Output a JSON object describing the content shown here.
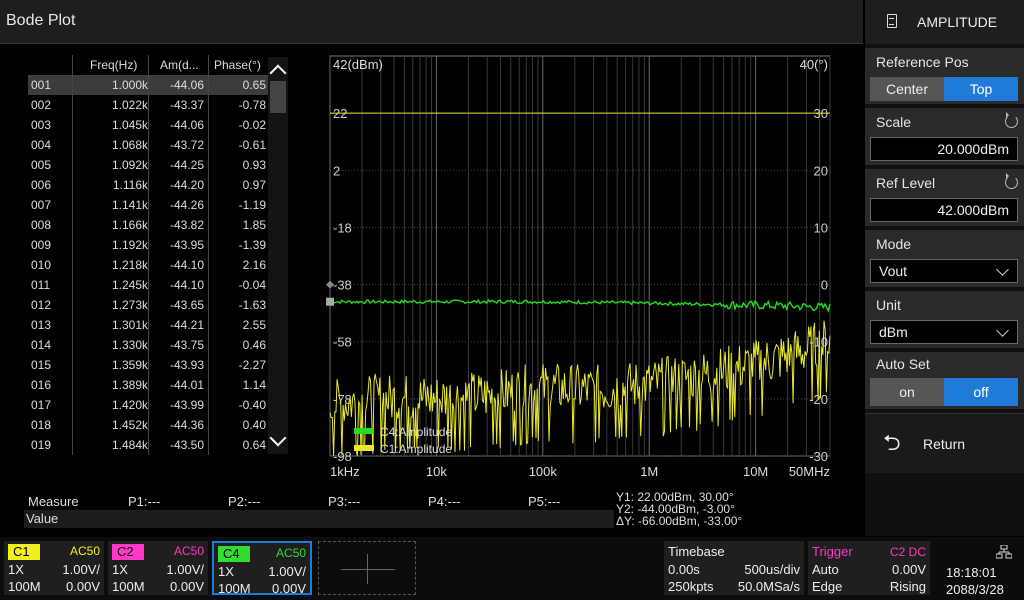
{
  "title": "Bode Plot",
  "panel": {
    "header": "AMPLITUDE",
    "reference_pos": {
      "label": "Reference Pos",
      "options": [
        "Center",
        "Top"
      ],
      "selected": "Top"
    },
    "scale": {
      "label": "Scale",
      "value": "20.000dBm"
    },
    "ref_level": {
      "label": "Ref Level",
      "value": "42.000dBm"
    },
    "mode": {
      "label": "Mode",
      "value": "Vout"
    },
    "unit": {
      "label": "Unit",
      "value": "dBm"
    },
    "auto_set": {
      "label": "Auto Set",
      "options": [
        "on",
        "off"
      ],
      "selected": "off"
    },
    "return_label": "Return"
  },
  "table": {
    "headers": [
      "Freq(Hz)",
      "Am(d...",
      "Phase(°)"
    ],
    "rows": [
      [
        "001",
        "1.000k",
        "-44.06",
        "0.65"
      ],
      [
        "002",
        "1.022k",
        "-43.37",
        "-0.78"
      ],
      [
        "003",
        "1.045k",
        "-44.06",
        "-0.02"
      ],
      [
        "004",
        "1.068k",
        "-43.72",
        "-0.61"
      ],
      [
        "005",
        "1.092k",
        "-44.25",
        "0.93"
      ],
      [
        "006",
        "1.116k",
        "-44.20",
        "0.97"
      ],
      [
        "007",
        "1.141k",
        "-44.26",
        "-1.19"
      ],
      [
        "008",
        "1.166k",
        "-43.82",
        "1.85"
      ],
      [
        "009",
        "1.192k",
        "-43.95",
        "-1.39"
      ],
      [
        "010",
        "1.218k",
        "-44.10",
        "2.16"
      ],
      [
        "011",
        "1.245k",
        "-44.10",
        "-0.04"
      ],
      [
        "012",
        "1.273k",
        "-43.65",
        "-1.63"
      ],
      [
        "013",
        "1.301k",
        "-44.21",
        "2.55"
      ],
      [
        "014",
        "1.330k",
        "-43.75",
        "0.46"
      ],
      [
        "015",
        "1.359k",
        "-43.93",
        "-2.27"
      ],
      [
        "016",
        "1.389k",
        "-44.01",
        "1.14"
      ],
      [
        "017",
        "1.420k",
        "-43.99",
        "-0.40"
      ],
      [
        "018",
        "1.452k",
        "-44.36",
        "0.40"
      ],
      [
        "019",
        "1.484k",
        "-43.50",
        "0.64"
      ]
    ]
  },
  "chart_data": {
    "type": "line",
    "y_left_title": "42(dBm)",
    "y_right_title": "40(°)",
    "y_left_ticks": [
      "22",
      "2",
      "-18",
      "-38",
      "-58",
      "-78",
      "-98"
    ],
    "y_left_range": [
      -98,
      42
    ],
    "y_right_ticks": [
      "30",
      "20",
      "10",
      "0",
      "-10",
      "-20",
      "-30"
    ],
    "y_right_range": [
      -30,
      40
    ],
    "x_scale": "log",
    "x_range": [
      1000,
      50000000
    ],
    "x_tick_labels": [
      "1kHz",
      "10k",
      "100k",
      "1M",
      "10M",
      "50MHz"
    ],
    "x_tick_values": [
      1000,
      10000,
      100000,
      1000000,
      10000000,
      50000000
    ],
    "grid": true,
    "legend_position": "bottom-left",
    "series": [
      {
        "name": "C4:Amplitude",
        "color": "#22dd22",
        "axis": "left",
        "x": [
          1000,
          10000,
          100000,
          1000000,
          5000000,
          20000000,
          50000000
        ],
        "values": [
          -44,
          -44,
          -44,
          -44.5,
          -45,
          -45.5,
          -46
        ]
      },
      {
        "name": "C1:Amplitude",
        "color": "#e8e830",
        "axis": "left",
        "x": [
          1000,
          3000,
          10000,
          30000,
          100000,
          300000,
          1000000,
          3000000,
          10000000,
          30000000,
          50000000
        ],
        "values": [
          -80,
          -78,
          -78,
          -77,
          -74,
          -75,
          -73,
          -70,
          -66,
          -61,
          -58
        ]
      }
    ],
    "cursor_line": {
      "axis": "left",
      "value": 22,
      "color": "#e8e830"
    }
  },
  "measure": {
    "label": "Measure",
    "value_label": "Value",
    "p1": "P1:---",
    "p2": "P2:---",
    "p3": "P3:---",
    "p4": "P4:---",
    "p5": "P5:---"
  },
  "cursor": {
    "y1": "Y1: 22.00dBm, 30.00°",
    "y2": "Y2: -44.00dBm, -3.00°",
    "dy": "ΔY: -66.00dBm, -33.00°"
  },
  "channels": [
    {
      "tag": "C1",
      "coupling": "AC50",
      "probe": "1X",
      "scale": "1.00V/",
      "bw": "100M",
      "offset": "0.00V",
      "color": "#f0f020"
    },
    {
      "tag": "C2",
      "coupling": "AC50",
      "probe": "1X",
      "scale": "1.00V/",
      "bw": "100M",
      "offset": "0.00V",
      "color": "#ff38c8"
    },
    {
      "tag": "C4",
      "coupling": "AC50",
      "probe": "1X",
      "scale": "1.00V/",
      "bw": "100M",
      "offset": "0.00V",
      "color": "#30dd30"
    }
  ],
  "timebase": {
    "label": "Timebase",
    "delay": "0.00s",
    "scale": "500us/div",
    "points": "250kpts",
    "rate": "50.0MSa/s"
  },
  "trigger": {
    "label": "Trigger",
    "source": "C2 DC",
    "mode": "Auto",
    "level": "0.00V",
    "type": "Edge",
    "slope": "Rising"
  },
  "clock": {
    "time": "18:18:01",
    "date": "2088/3/28"
  }
}
